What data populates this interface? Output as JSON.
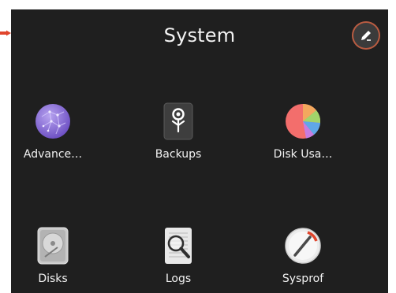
{
  "window": {
    "title": "System"
  },
  "header": {
    "edit_icon": "pencil-icon"
  },
  "apps": [
    {
      "label": "Advance…",
      "icon": "advanced-network-icon"
    },
    {
      "label": "Backups",
      "icon": "backups-icon"
    },
    {
      "label": "Disk Usa…",
      "icon": "disk-usage-pie-icon"
    },
    {
      "label": "Disks",
      "icon": "disks-icon"
    },
    {
      "label": "Logs",
      "icon": "logs-magnifier-icon"
    },
    {
      "label": "Sysprof",
      "icon": "sysprof-gauge-icon"
    }
  ],
  "colors": {
    "background": "#1f1f1f",
    "accent": "#b85b41",
    "pointer": "#e0452c"
  }
}
